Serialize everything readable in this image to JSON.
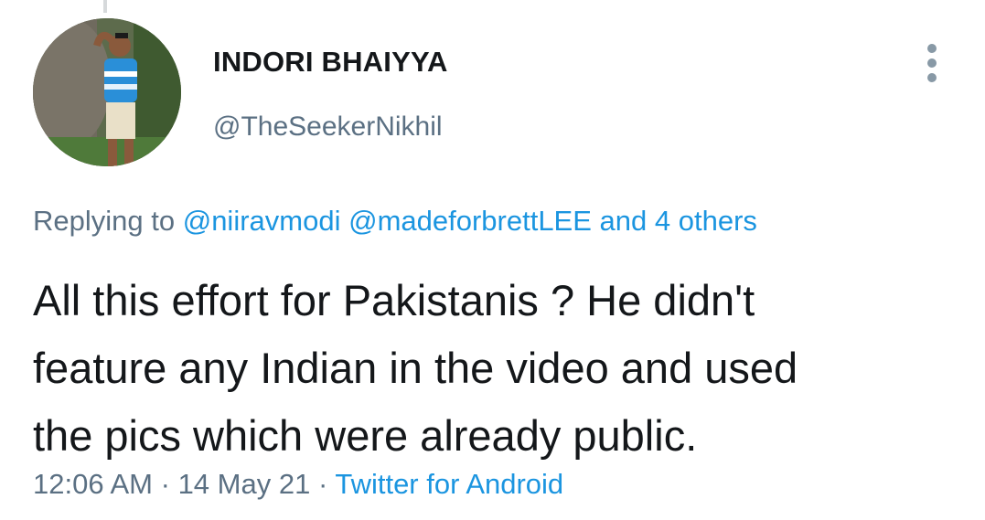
{
  "tweet": {
    "display_name": "INDORI BHAIYYA",
    "handle": "@TheSeekerNikhil",
    "replying_prefix": "Replying to",
    "reply_mentions": [
      "@niiravmodi",
      "@madeforbrettLEE"
    ],
    "reply_others": "and 4 others",
    "text_lines": [
      "All this effort for Pakistanis ? He didn't",
      "feature any Indian in the video and used",
      "the pics which were already public."
    ],
    "time": "12:06 AM",
    "date": "14 May 21",
    "separator": "·",
    "source": "Twitter for Android"
  },
  "icons": {
    "more": "more-vertical-icon"
  },
  "colors": {
    "text": "#14171a",
    "secondary": "#5b7083",
    "link": "#1b95e0"
  }
}
